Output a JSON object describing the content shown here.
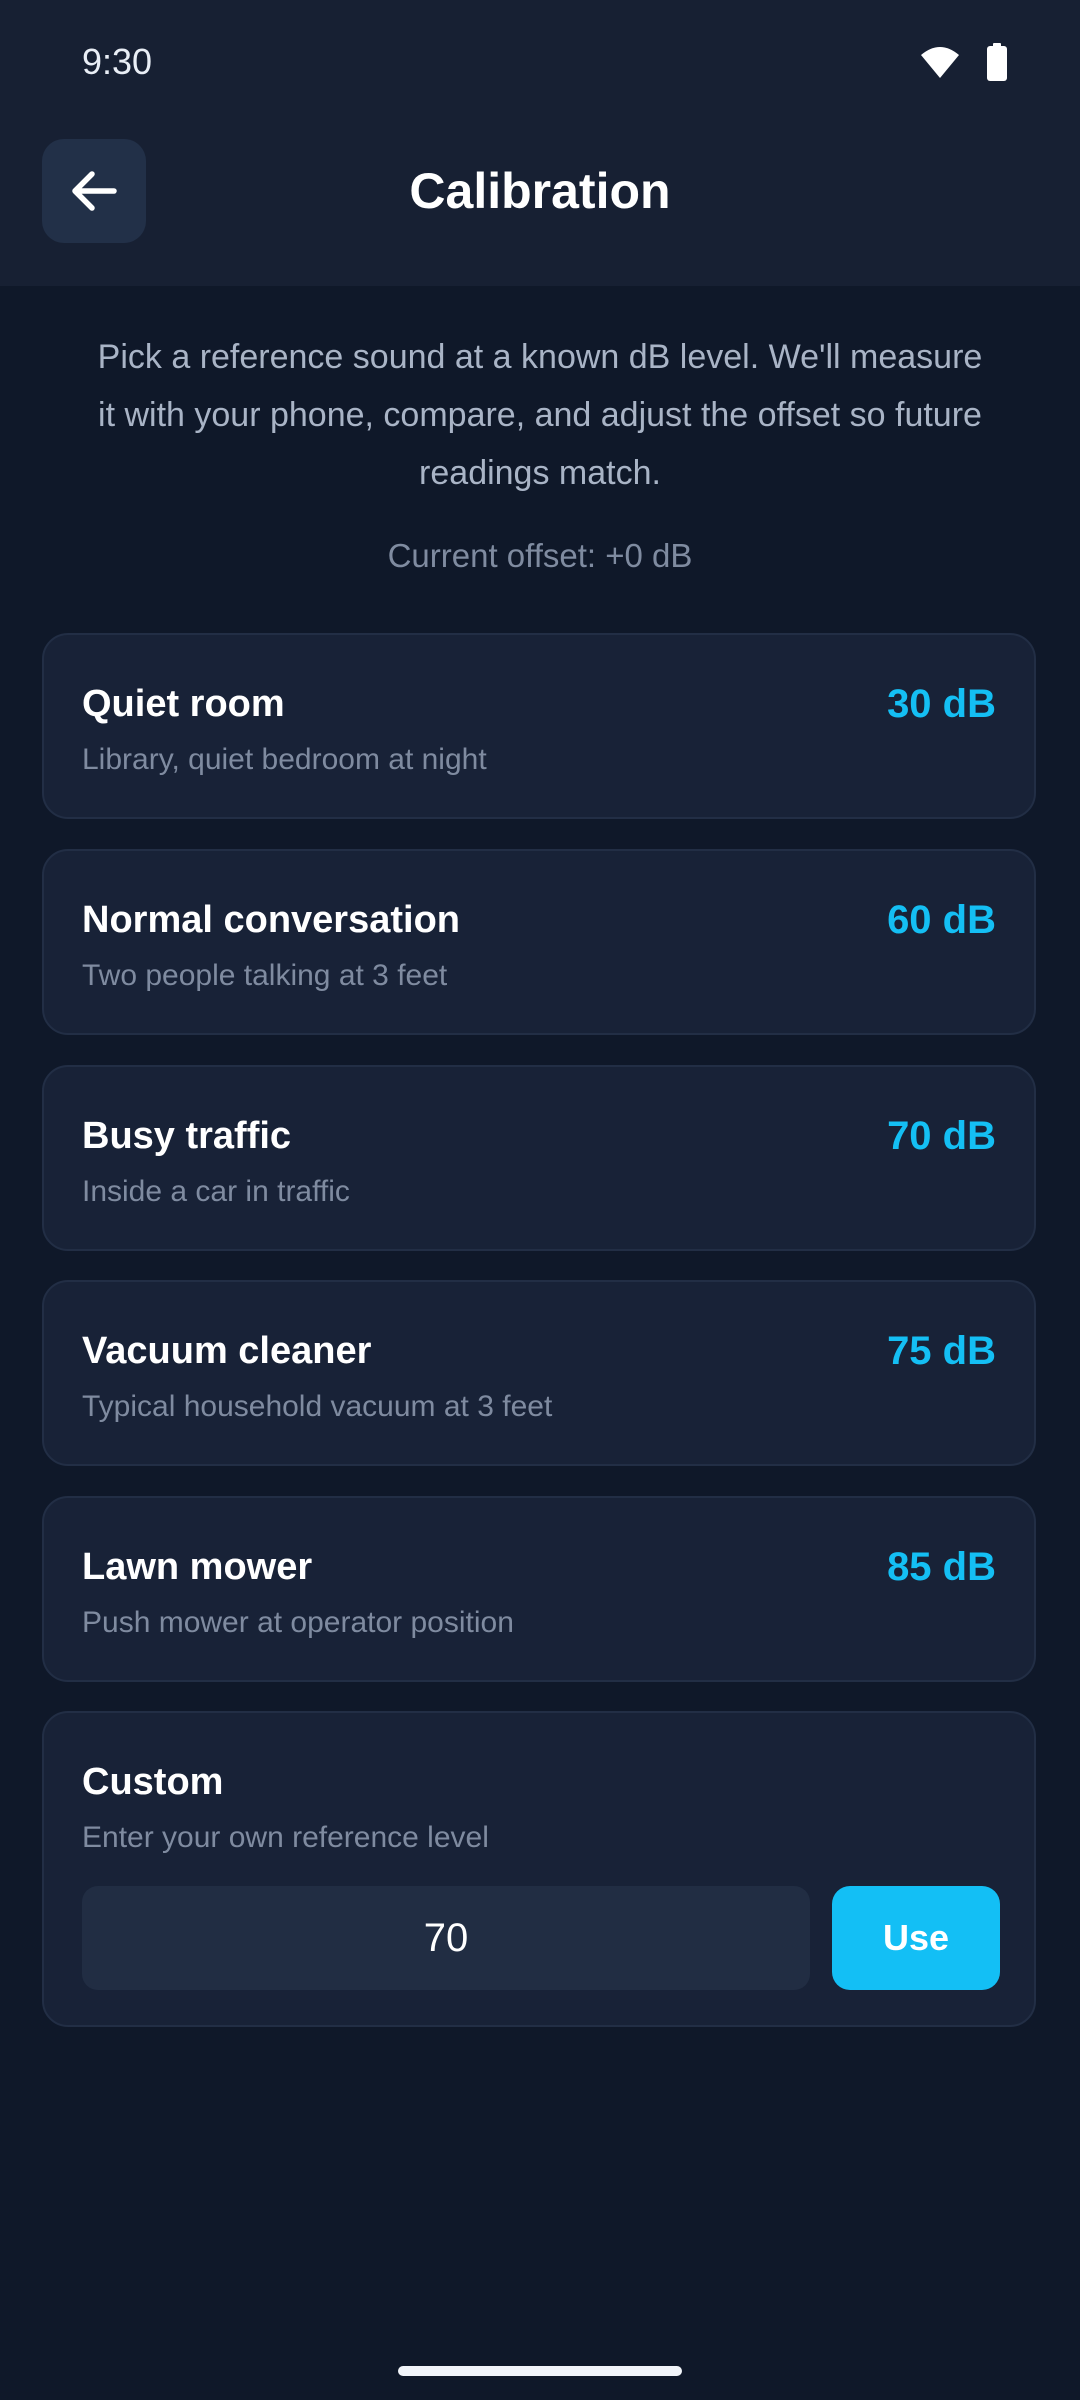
{
  "status_bar": {
    "time": "9:30",
    "icons": [
      "wifi-icon",
      "battery-icon"
    ]
  },
  "header": {
    "title": "Calibration",
    "back_icon": "arrow-left-icon"
  },
  "intro_text": "Pick a reference sound at a known dB level. We'll measure it with your phone, compare, and adjust the offset so future readings match.",
  "current_offset": "Current offset: +0 dB",
  "references": [
    {
      "title": "Quiet room",
      "subtitle": "Library, quiet bedroom at night",
      "level": "30 dB"
    },
    {
      "title": "Normal conversation",
      "subtitle": "Two people talking at 3 feet",
      "level": "60 dB"
    },
    {
      "title": "Busy traffic",
      "subtitle": "Inside a car in traffic",
      "level": "70 dB"
    },
    {
      "title": "Vacuum cleaner",
      "subtitle": "Typical household vacuum at 3 feet",
      "level": "75 dB"
    },
    {
      "title": "Lawn mower",
      "subtitle": "Push mower at operator position",
      "level": "85 dB"
    }
  ],
  "custom": {
    "title": "Custom",
    "subtitle": "Enter your own reference level",
    "value": "70",
    "button_label": "Use"
  },
  "colors": {
    "background": "#0f1829",
    "header": "#172033",
    "card": "#182237",
    "accent": "#14bff4",
    "muted_text": "#7f8ba0"
  }
}
